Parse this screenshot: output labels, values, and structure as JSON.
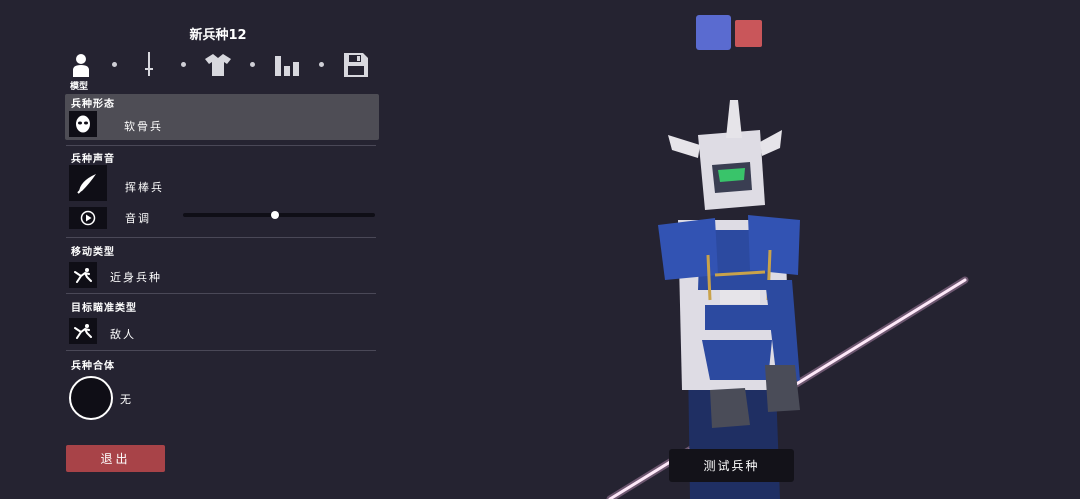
{
  "unit_title": "新兵种12",
  "tabs": [
    {
      "name": "model",
      "caption": "模型",
      "icon": "person-icon",
      "active": true
    },
    {
      "name": "weapon",
      "icon": "sword-icon"
    },
    {
      "name": "clothing",
      "icon": "shirt-icon"
    },
    {
      "name": "stats",
      "icon": "bar-chart-icon"
    },
    {
      "name": "save",
      "icon": "floppy-disk-icon"
    }
  ],
  "sections": {
    "form": {
      "label": "兵种形态",
      "value": "软骨兵",
      "icon": "mask-icon"
    },
    "voice": {
      "label": "兵种声音",
      "value": "挥棒兵",
      "icon": "sword-swing-icon",
      "pitch_label": "音调",
      "pitch_level": 0.48,
      "play_icon": "play-icon"
    },
    "movement": {
      "label": "移动类型",
      "value": "近身兵种",
      "icon": "runner-icon"
    },
    "targeting": {
      "label": "目标瞄准类型",
      "value": "敌人",
      "icon": "runner-icon"
    },
    "combine": {
      "label": "兵种合体",
      "value": "无"
    }
  },
  "buttons": {
    "exit": "退出",
    "test": "测试兵种"
  },
  "team_colors": {
    "blue": "#5a6bd0",
    "red": "#c9565a"
  },
  "colors": {
    "background": "#252331",
    "panel_selected": "#4e4d55",
    "exit_button": "#a84348",
    "unit_blue": "#2c4aa0",
    "unit_white": "#e6e4e9",
    "spear_glow": "#f4b8e6"
  }
}
